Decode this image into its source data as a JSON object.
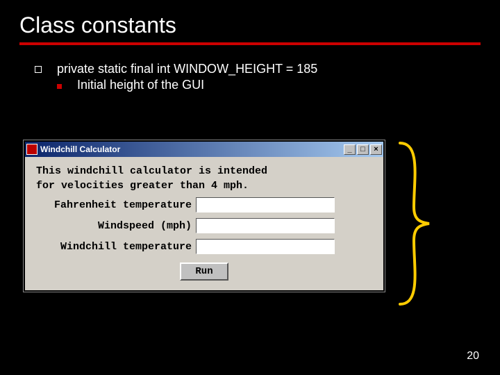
{
  "title": "Class constants",
  "bullet_text": "private static final int WINDOW_HEIGHT = 185",
  "sub_text": "Initial height of the GUI",
  "window": {
    "title": "Windchill Calculator",
    "intro_line1": "This windchill calculator is intended",
    "intro_line2": "for velocities greater than 4 mph.",
    "label_temp": "Fahrenheit temperature",
    "label_wind": "Windspeed (mph)",
    "label_chill": "Windchill temperature",
    "run": "Run",
    "min_glyph": "_",
    "max_glyph": "□",
    "close_glyph": "×"
  },
  "page_number": "20"
}
